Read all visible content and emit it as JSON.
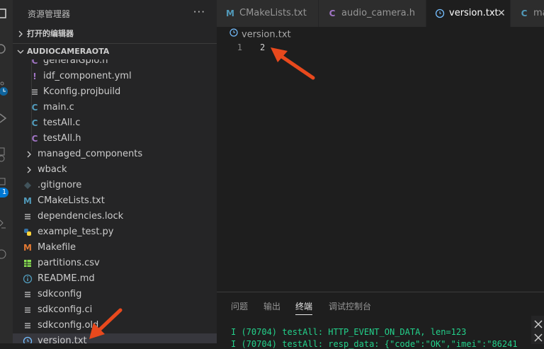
{
  "explorer": {
    "title": "资源管理器",
    "more": "···",
    "open_editors_label": "打开的编辑器",
    "folder_label": "AUDIOCAMERAOTA"
  },
  "activity_bar": {
    "icons": [
      "files-icon",
      "search-icon",
      "source-control-icon",
      "run-debug-icon",
      "remote-explorer-icon",
      "extensions-icon",
      "testing-icon",
      "espressif-icon"
    ],
    "badge_count": "1"
  },
  "tree": [
    {
      "name": "generalGpio.h",
      "icon": "h",
      "indent": 1
    },
    {
      "name": "idf_component.yml",
      "icon": "yml",
      "indent": 1
    },
    {
      "name": "Kconfig.projbuild",
      "icon": "lines",
      "indent": 1
    },
    {
      "name": "main.c",
      "icon": "c",
      "indent": 1
    },
    {
      "name": "testAll.c",
      "icon": "c",
      "indent": 1
    },
    {
      "name": "testAll.h",
      "icon": "h",
      "indent": 1
    },
    {
      "name": "managed_components",
      "icon": "chevron",
      "indent": 0
    },
    {
      "name": "wback",
      "icon": "chevron",
      "indent": 0
    },
    {
      "name": ".gitignore",
      "icon": "git",
      "indent": 0
    },
    {
      "name": "CMakeLists.txt",
      "icon": "m-blue",
      "indent": 0
    },
    {
      "name": "dependencies.lock",
      "icon": "lines",
      "indent": 0
    },
    {
      "name": "example_test.py",
      "icon": "python",
      "indent": 0
    },
    {
      "name": "Makefile",
      "icon": "m-orange",
      "indent": 0
    },
    {
      "name": "partitions.csv",
      "icon": "csv",
      "indent": 0
    },
    {
      "name": "README.md",
      "icon": "info",
      "indent": 0
    },
    {
      "name": "sdkconfig",
      "icon": "lines",
      "indent": 0
    },
    {
      "name": "sdkconfig.ci",
      "icon": "lines",
      "indent": 0
    },
    {
      "name": "sdkconfig.old",
      "icon": "lines",
      "indent": 0
    },
    {
      "name": "version.txt",
      "icon": "clock",
      "indent": 0,
      "selected": true
    }
  ],
  "tabs": [
    {
      "label": "CMakeLists.txt",
      "icon": "M"
    },
    {
      "label": "audio_camera.h",
      "icon": "C"
    },
    {
      "label": "version.txt",
      "icon": "clock",
      "active": true,
      "close": "✕"
    },
    {
      "label": "ma",
      "icon": "C"
    }
  ],
  "editor": {
    "breadcrumb": "version.txt",
    "lines": [
      {
        "number": "1",
        "text": "2"
      }
    ]
  },
  "panel": {
    "tabs": [
      "问题",
      "输出",
      "终端",
      "调试控制台"
    ],
    "active_tab": "终端",
    "lines": [
      "I (70704) testAll: HTTP_EVENT_ON_DATA, len=123",
      "I (70704) testAll: resp_data: {\"code\":\"OK\",\"imei\":\"86241"
    ]
  },
  "colors": {
    "annotation_arrow": "#e8491d",
    "terminal_text": "#23d18b",
    "c_icon": "#519aba",
    "h_icon": "#a074c4"
  }
}
